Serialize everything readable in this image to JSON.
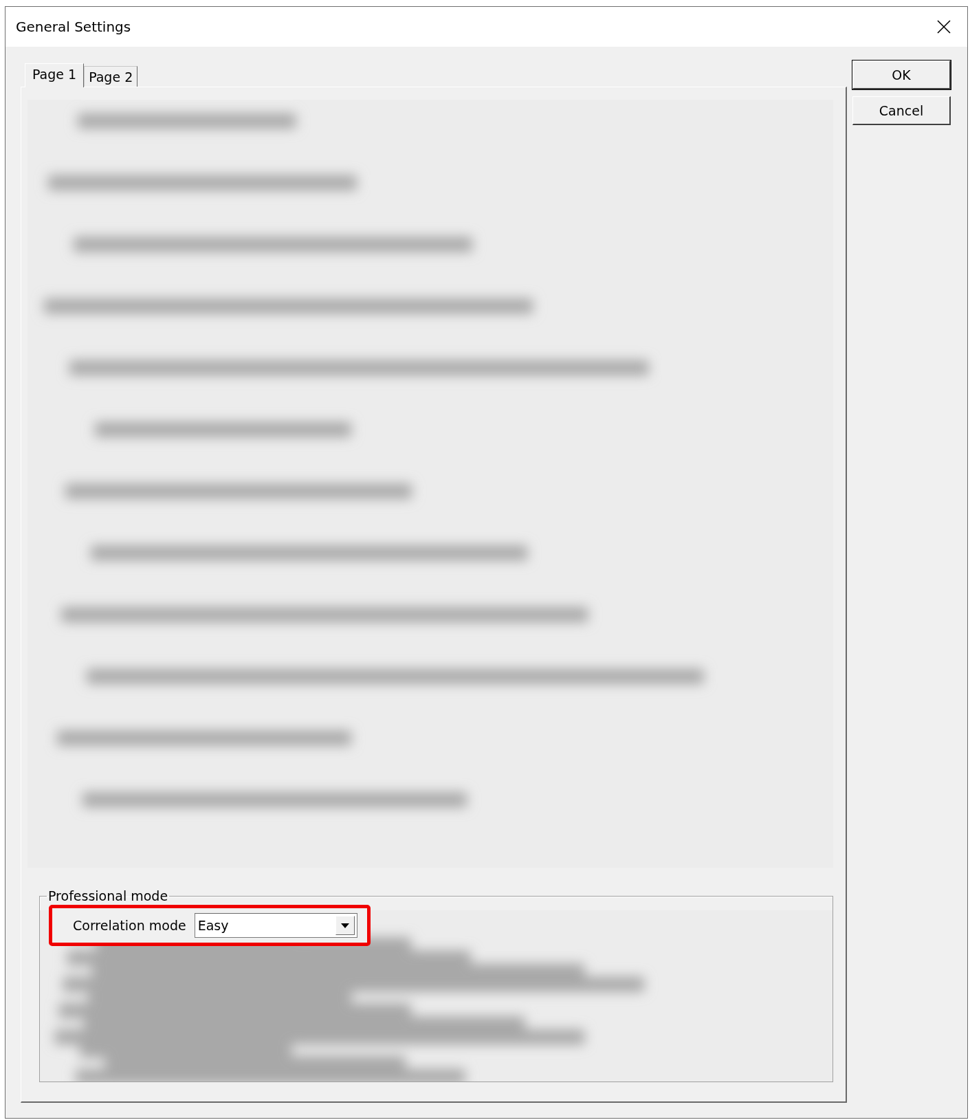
{
  "window": {
    "title": "General Settings"
  },
  "tabs": [
    {
      "label": "Page 1",
      "selected": true
    },
    {
      "label": "Page 2",
      "selected": false
    }
  ],
  "buttons": [
    "OK",
    "Cancel"
  ],
  "group": {
    "title": "Professional mode",
    "fields": [
      {
        "label": "Correlation mode",
        "value": "Easy",
        "highlighted": true
      }
    ]
  }
}
